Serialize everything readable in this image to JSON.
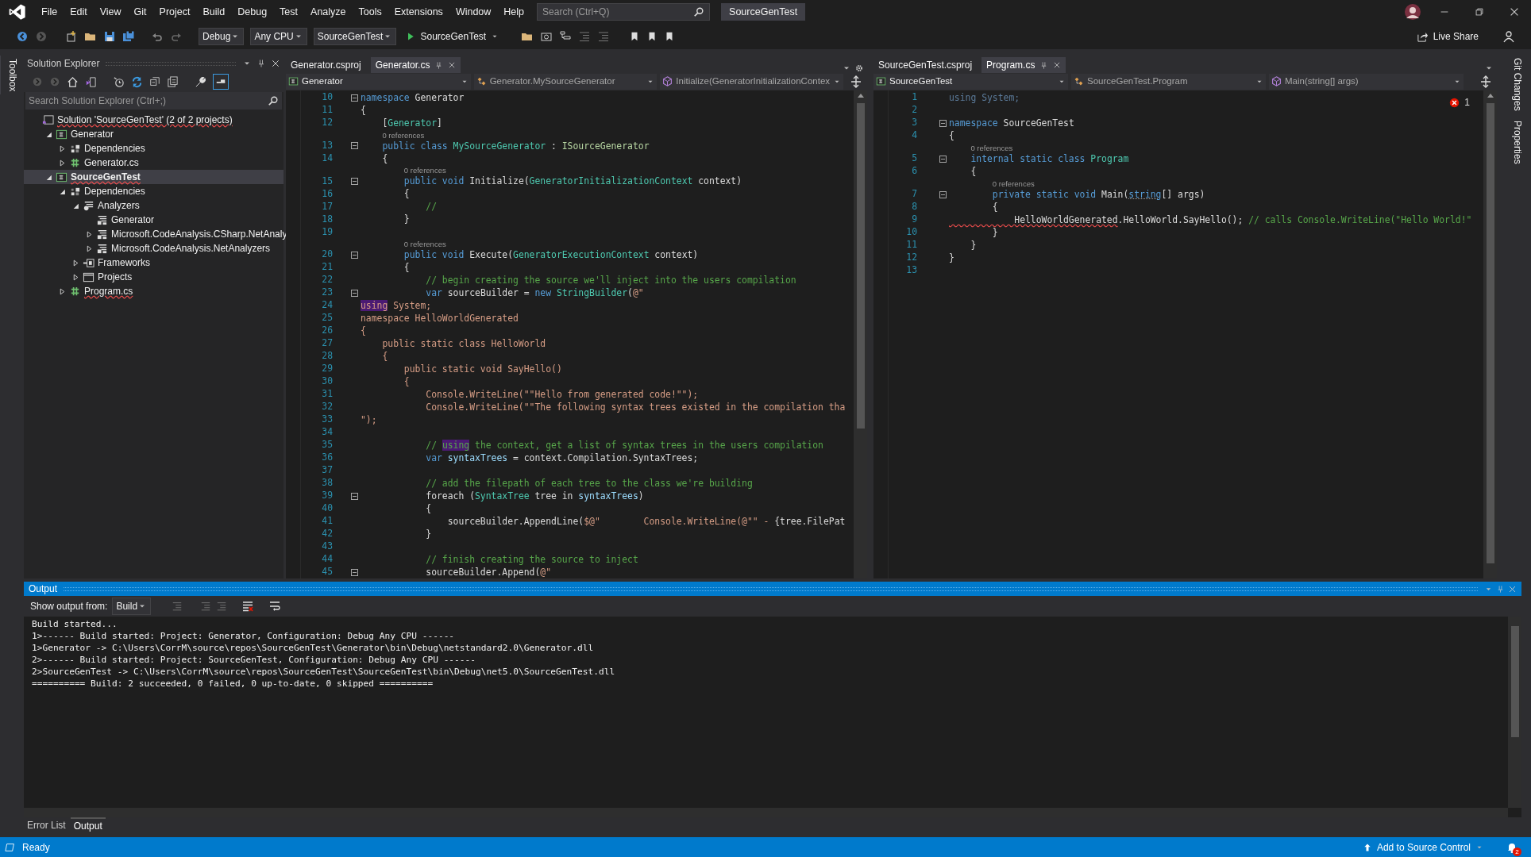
{
  "window": {
    "title": "SourceGenTest"
  },
  "menu": [
    "File",
    "Edit",
    "View",
    "Git",
    "Project",
    "Build",
    "Debug",
    "Test",
    "Analyze",
    "Tools",
    "Extensions",
    "Window",
    "Help"
  ],
  "search": {
    "placeholder": "Search (Ctrl+Q)"
  },
  "toolbar": {
    "configuration": "Debug",
    "platform": "Any CPU",
    "startup_project": "SourceGenTest",
    "run": "SourceGenTest",
    "live_share": "Live Share"
  },
  "side_tabs_left": [
    "Toolbox"
  ],
  "side_tabs_right": [
    "Git Changes",
    "Properties"
  ],
  "solution_explorer": {
    "title": "Solution Explorer",
    "search": {
      "placeholder": "Search Solution Explorer (Ctrl+;)"
    },
    "tree": [
      {
        "kind": "solution",
        "label": "Solution 'SourceGenTest' (2 of 2 projects)",
        "selected": false,
        "startup": false,
        "squiggle": true,
        "children": [
          {
            "kind": "project",
            "label": "Generator",
            "expanded": true,
            "selected": false,
            "startup": false,
            "squiggle": false,
            "children": [
              {
                "kind": "dependencies",
                "label": "Dependencies",
                "expanded": false,
                "selected": false,
                "startup": false,
                "squiggle": false
              },
              {
                "kind": "csfile",
                "label": "Generator.cs",
                "expanded": false,
                "selected": false,
                "startup": false,
                "squiggle": false
              }
            ]
          },
          {
            "kind": "project",
            "label": "SourceGenTest",
            "expanded": true,
            "selected": true,
            "startup": true,
            "squiggle": true,
            "children": [
              {
                "kind": "dependencies",
                "label": "Dependencies",
                "expanded": true,
                "selected": false,
                "startup": false,
                "squiggle": false,
                "children": [
                  {
                    "kind": "analyzers",
                    "label": "Analyzers",
                    "expanded": true,
                    "selected": false,
                    "startup": false,
                    "squiggle": false,
                    "children": [
                      {
                        "kind": "analyzer",
                        "label": "Generator",
                        "selected": false,
                        "startup": false,
                        "squiggle": false
                      },
                      {
                        "kind": "analyzer",
                        "label": "Microsoft.CodeAnalysis.CSharp.NetAnaly",
                        "expanded": false,
                        "selected": false,
                        "startup": false,
                        "squiggle": false
                      },
                      {
                        "kind": "analyzer",
                        "label": "Microsoft.CodeAnalysis.NetAnalyzers",
                        "expanded": false,
                        "selected": false,
                        "startup": false,
                        "squiggle": false
                      }
                    ]
                  },
                  {
                    "kind": "frameworks",
                    "label": "Frameworks",
                    "expanded": false,
                    "selected": false,
                    "startup": false,
                    "squiggle": false
                  },
                  {
                    "kind": "projects",
                    "label": "Projects",
                    "expanded": false,
                    "selected": false,
                    "startup": false,
                    "squiggle": false
                  }
                ]
              },
              {
                "kind": "csfile",
                "label": "Program.cs",
                "expanded": false,
                "selected": false,
                "startup": false,
                "squiggle": true
              }
            ]
          }
        ]
      }
    ]
  },
  "editors": [
    {
      "tabs": [
        {
          "label": "Generator.csproj",
          "selected": false
        },
        {
          "label": "Generator.cs",
          "selected": true
        }
      ],
      "nav": [
        {
          "kind": "project",
          "text": "Generator"
        },
        {
          "kind": "class",
          "text": "Generator.MySourceGenerator"
        },
        {
          "kind": "method",
          "text": "Initialize(GeneratorInitializationContex"
        }
      ],
      "lines": [
        {
          "number": "10",
          "fold": true,
          "tokens": [
            {
              "kind": "keyword",
              "text": "namespace"
            },
            {
              "kind": "text",
              "text": " Generator"
            }
          ]
        },
        {
          "number": "11",
          "fold": false,
          "tokens": [
            {
              "kind": "text",
              "text": "{"
            }
          ]
        },
        {
          "number": "12",
          "fold": false,
          "tokens": [
            {
              "kind": "text",
              "text": "    ["
            },
            {
              "kind": "type",
              "text": "Generator"
            },
            {
              "kind": "text",
              "text": "]"
            }
          ]
        },
        {
          "number": "13",
          "fold": true,
          "lens": "0 references",
          "tokens": [
            {
              "kind": "keyword",
              "text": "    public class "
            },
            {
              "kind": "type",
              "text": "MySourceGenerator"
            },
            {
              "kind": "text",
              "text": " : "
            },
            {
              "kind": "interface",
              "text": "ISourceGenerator"
            }
          ]
        },
        {
          "number": "14",
          "fold": false,
          "tokens": [
            {
              "kind": "text",
              "text": "    {"
            }
          ]
        },
        {
          "number": "15",
          "fold": true,
          "lens": "0 references",
          "tokens": [
            {
              "kind": "keyword",
              "text": "        public void"
            },
            {
              "kind": "text",
              "text": " Initialize("
            },
            {
              "kind": "type",
              "text": "GeneratorInitializationContext"
            },
            {
              "kind": "text",
              "text": " context)"
            }
          ]
        },
        {
          "number": "16",
          "fold": false,
          "tokens": [
            {
              "kind": "text",
              "text": "        {"
            }
          ]
        },
        {
          "number": "17",
          "fold": false,
          "tokens": [
            {
              "kind": "comment",
              "text": "            //"
            }
          ]
        },
        {
          "number": "18",
          "fold": false,
          "tokens": [
            {
              "kind": "text",
              "text": "        }"
            }
          ]
        },
        {
          "number": "19",
          "fold": false
        },
        {
          "number": "20",
          "fold": true,
          "lens": "0 references",
          "tokens": [
            {
              "kind": "keyword",
              "text": "        public void"
            },
            {
              "kind": "text",
              "text": " Execute("
            },
            {
              "kind": "type",
              "text": "GeneratorExecutionContext"
            },
            {
              "kind": "text",
              "text": " context)"
            }
          ]
        },
        {
          "number": "21",
          "fold": false,
          "tokens": [
            {
              "kind": "text",
              "text": "        {"
            }
          ]
        },
        {
          "number": "22",
          "fold": false,
          "tokens": [
            {
              "kind": "comment",
              "text": "            // begin creating the source we'll inject into the users compilation"
            }
          ]
        },
        {
          "number": "23",
          "fold": true,
          "tokens": [
            {
              "kind": "keyword",
              "text": "            var"
            },
            {
              "kind": "text",
              "text": " sourceBuilder = "
            },
            {
              "kind": "keyword",
              "text": "new "
            },
            {
              "kind": "type",
              "text": "StringBuilder"
            },
            {
              "kind": "text",
              "text": "("
            },
            {
              "kind": "string",
              "text": "@\""
            }
          ]
        },
        {
          "number": "24",
          "fold": false,
          "tokens": [
            {
              "kind": "string_match",
              "text": "using"
            },
            {
              "kind": "string",
              "text": " System;"
            }
          ]
        },
        {
          "number": "25",
          "fold": false,
          "tokens": [
            {
              "kind": "string",
              "text": "namespace HelloWorldGenerated"
            }
          ]
        },
        {
          "number": "26",
          "fold": false,
          "tokens": [
            {
              "kind": "string",
              "text": "{"
            }
          ]
        },
        {
          "number": "27",
          "fold": false,
          "tokens": [
            {
              "kind": "string",
              "text": "    public static class HelloWorld"
            }
          ]
        },
        {
          "number": "28",
          "fold": false,
          "tokens": [
            {
              "kind": "string",
              "text": "    {"
            }
          ]
        },
        {
          "number": "29",
          "fold": false,
          "tokens": [
            {
              "kind": "string",
              "text": "        public static void SayHello()"
            }
          ]
        },
        {
          "number": "30",
          "fold": false,
          "tokens": [
            {
              "kind": "string",
              "text": "        {"
            }
          ]
        },
        {
          "number": "31",
          "fold": false,
          "tokens": [
            {
              "kind": "string",
              "text": "            Console.WriteLine(\"\"Hello from generated code!\"\");"
            }
          ]
        },
        {
          "number": "32",
          "fold": false,
          "tokens": [
            {
              "kind": "string",
              "text": "            Console.WriteLine(\"\"The following syntax trees existed in the compilation tha"
            }
          ]
        },
        {
          "number": "33",
          "fold": false,
          "tokens": [
            {
              "kind": "string",
              "text": "\");"
            }
          ]
        },
        {
          "number": "34",
          "fold": false
        },
        {
          "number": "35",
          "fold": false,
          "tokens": [
            {
              "kind": "comment",
              "text": "            // "
            },
            {
              "kind": "comment_match",
              "text": "using"
            },
            {
              "kind": "comment",
              "text": " the context, get a list of syntax trees in the users compilation"
            }
          ]
        },
        {
          "number": "36",
          "fold": false,
          "tokens": [
            {
              "kind": "keyword",
              "text": "            var "
            },
            {
              "kind": "local",
              "text": "syntaxTrees"
            },
            {
              "kind": "text",
              "text": " = context.Compilation.SyntaxTrees;"
            }
          ]
        },
        {
          "number": "37",
          "fold": false
        },
        {
          "number": "38",
          "fold": false,
          "tokens": [
            {
              "kind": "comment",
              "text": "            // add the filepath of each tree to the class we're building"
            }
          ]
        },
        {
          "number": "39",
          "fold": true,
          "tokens": [
            {
              "kind": "text",
              "text": "            foreach ("
            },
            {
              "kind": "type",
              "text": "SyntaxTree"
            },
            {
              "kind": "text",
              "text": " tree in "
            },
            {
              "kind": "local",
              "text": "syntaxTrees"
            },
            {
              "kind": "text",
              "text": ")"
            }
          ]
        },
        {
          "number": "40",
          "fold": false,
          "tokens": [
            {
              "kind": "text",
              "text": "            {"
            }
          ]
        },
        {
          "number": "41",
          "fold": false,
          "tokens": [
            {
              "kind": "text",
              "text": "                sourceBuilder.AppendLine("
            },
            {
              "kind": "string",
              "text": "$@\"        Console.WriteLine(@\"\" - "
            },
            {
              "kind": "text",
              "text": "{tree.FilePat"
            }
          ]
        },
        {
          "number": "42",
          "fold": false,
          "tokens": [
            {
              "kind": "text",
              "text": "            }"
            }
          ]
        },
        {
          "number": "43",
          "fold": false
        },
        {
          "number": "44",
          "fold": false,
          "tokens": [
            {
              "kind": "comment",
              "text": "            // finish creating the source to inject"
            }
          ]
        },
        {
          "number": "45",
          "fold": true,
          "tokens": [
            {
              "kind": "text",
              "text": "            sourceBuilder.Append("
            },
            {
              "kind": "string",
              "text": "@\""
            }
          ]
        }
      ]
    },
    {
      "tabs": [
        {
          "label": "SourceGenTest.csproj",
          "selected": false
        },
        {
          "label": "Program.cs",
          "selected": true
        }
      ],
      "nav": [
        {
          "kind": "project",
          "text": "SourceGenTest"
        },
        {
          "kind": "class",
          "text": "SourceGenTest.Program"
        },
        {
          "kind": "method",
          "text": "Main(string[] args)"
        }
      ],
      "error_count": "1",
      "lines": [
        {
          "number": "1",
          "fold": false,
          "tokens": [
            {
              "kind": "unused",
              "text": "using System;"
            }
          ]
        },
        {
          "number": "2",
          "fold": false
        },
        {
          "number": "3",
          "fold": true,
          "tokens": [
            {
              "kind": "keyword",
              "text": "namespace"
            },
            {
              "kind": "text",
              "text": " SourceGenTest"
            }
          ]
        },
        {
          "number": "4",
          "fold": false,
          "tokens": [
            {
              "kind": "text",
              "text": "{"
            }
          ]
        },
        {
          "number": "5",
          "fold": true,
          "lens": "0 references",
          "tokens": [
            {
              "kind": "keyword",
              "text": "    internal static class "
            },
            {
              "kind": "type",
              "text": "Program"
            }
          ]
        },
        {
          "number": "6",
          "fold": false,
          "tokens": [
            {
              "kind": "text",
              "text": "    {"
            }
          ]
        },
        {
          "number": "7",
          "fold": true,
          "lens": "0 references",
          "tokens": [
            {
              "kind": "keyword",
              "text": "        private static void"
            },
            {
              "kind": "text",
              "text": " Main("
            },
            {
              "kind": "hint",
              "text": "string"
            },
            {
              "kind": "text",
              "text": "[] args)"
            }
          ]
        },
        {
          "number": "8",
          "fold": false,
          "tokens": [
            {
              "kind": "text",
              "text": "        {"
            }
          ]
        },
        {
          "number": "9",
          "fold": false,
          "tokens": [
            {
              "kind": "error",
              "text": "            HelloWorldGenerated"
            },
            {
              "kind": "text",
              "text": ".HelloWorld.SayHello(); "
            },
            {
              "kind": "comment",
              "text": "// calls Console.WriteLine(\"Hello World!\""
            }
          ]
        },
        {
          "number": "10",
          "fold": false,
          "tokens": [
            {
              "kind": "text",
              "text": "        }"
            }
          ]
        },
        {
          "number": "11",
          "fold": false,
          "tokens": [
            {
              "kind": "text",
              "text": "    }"
            }
          ]
        },
        {
          "number": "12",
          "fold": false,
          "tokens": [
            {
              "kind": "text",
              "text": "}"
            }
          ]
        },
        {
          "number": "13",
          "fold": false
        }
      ]
    }
  ],
  "output": {
    "title": "Output",
    "source_label": "Show output from:",
    "source": "Build",
    "lines": [
      "Build started...",
      "1>------ Build started: Project: Generator, Configuration: Debug Any CPU ------",
      "1>Generator -> C:\\Users\\CorrM\\source\\repos\\SourceGenTest\\Generator\\bin\\Debug\\netstandard2.0\\Generator.dll",
      "2>------ Build started: Project: SourceGenTest, Configuration: Debug Any CPU ------",
      "2>SourceGenTest -> C:\\Users\\CorrM\\source\\repos\\SourceGenTest\\SourceGenTest\\bin\\Debug\\net5.0\\SourceGenTest.dll",
      "========== Build: 2 succeeded, 0 failed, 0 up-to-date, 0 skipped =========="
    ]
  },
  "bottom_tabs": [
    {
      "label": "Error List",
      "selected": false
    },
    {
      "label": "Output",
      "selected": true
    }
  ],
  "status_bar": {
    "text": "Ready",
    "source_control": "Add to Source Control",
    "notifications": "2"
  }
}
